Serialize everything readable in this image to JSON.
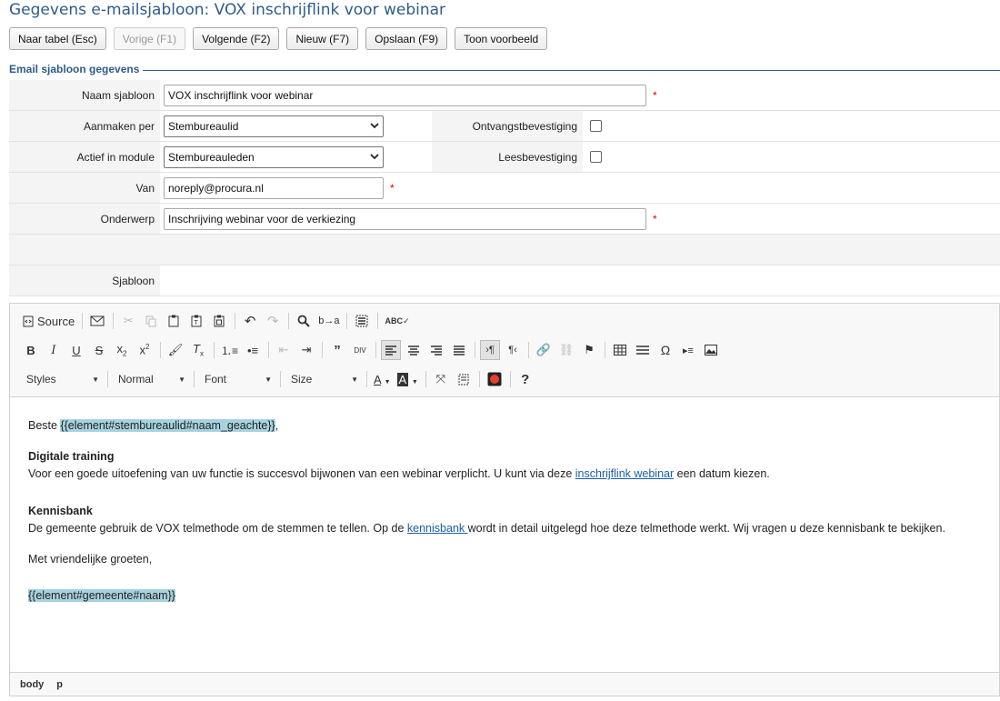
{
  "page_title": "Gegevens e-mailsjabloon: VOX inschrijflink voor webinar",
  "actions": [
    "Naar tabel (Esc)",
    "Vorige (F1)",
    "Volgende (F2)",
    "Nieuw (F7)",
    "Opslaan (F9)",
    "Toon voorbeeld"
  ],
  "section_legend": "Email sjabloon gegevens",
  "form": {
    "naam_label": "Naam sjabloon",
    "naam_value": "VOX inschrijflink voor webinar",
    "aanmaken_label": "Aanmaken per",
    "aanmaken_value": "Stembureaulid",
    "ontvangst_label": "Ontvangstbevestiging",
    "actief_label": "Actief in module",
    "actief_value": "Stembureauleden",
    "lees_label": "Leesbevestiging",
    "van_label": "Van",
    "van_value": "noreply@procura.nl",
    "onderwerp_label": "Onderwerp",
    "onderwerp_value": "Inschrijving webinar voor de verkiezing",
    "sjabloon_label": "Sjabloon",
    "required_mark": "*"
  },
  "editor": {
    "source_label": "Source",
    "styles_label": "Styles",
    "format_label": "Normal",
    "font_label": "Font",
    "size_label": "Size",
    "body": {
      "greeting": "Beste ",
      "greeting_placeholder": "{{element#stembureaulid#naam_geachte}}",
      "greeting_end": ",",
      "h1": "Digitale training",
      "p1_start": "Voor een goede uitoefening van uw functie is succesvol bijwonen van een webinar verplicht. U kunt via deze ",
      "p1_link": "inschrijflink webinar",
      "p1_end": " een datum kiezen.",
      "h2": "Kennisbank",
      "p2_start": "De gemeente gebruik de VOX telmethode om de stemmen te tellen. Op de ",
      "p2_link": "kennisbank ",
      "p2_end": "wordt in detail uitgelegd hoe deze telmethode werkt. Wij vragen u deze kennisbank te bekijken.",
      "closing": "Met vriendelijke groeten,",
      "signature_placeholder": "{{element#gemeente#naam}}"
    },
    "status_path": [
      "body",
      "p"
    ]
  },
  "icons": {
    "link_color": "#1a5fa8",
    "placeholder_bg": "#a7d3e0",
    "title_color": "#2e5c8a"
  }
}
